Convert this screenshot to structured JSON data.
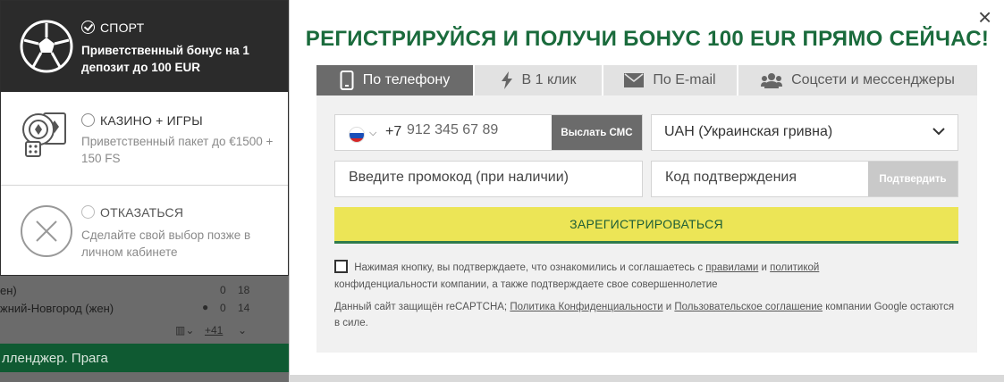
{
  "background": {
    "row1_team": "ен)",
    "row1_score1": "0",
    "row1_score2": "18",
    "row2_team": "жний-Новгород (жен)",
    "row2_score1": "0",
    "row2_score2": "14",
    "more_markets": "+41",
    "league": "лленджер. Прага"
  },
  "bonus_options": [
    {
      "title": "СПОРТ",
      "desc": "Приветственный бонус на 1 депозит до 100 EUR",
      "icon": "soccer-ball-icon",
      "selected": true
    },
    {
      "title": "КАЗИНО + ИГРЫ",
      "desc": "Приветственный пакет до €1500 + 150 FS",
      "icon": "casino-chip-cards-icon",
      "selected": false
    },
    {
      "title": "ОТКАЗАТЬСЯ",
      "desc": "Сделайте свой выбор позже в личном кабинете",
      "icon": "close-circle-icon",
      "selected": false
    }
  ],
  "modal": {
    "headline": "РЕГИСТРИРУЙСЯ И ПОЛУЧИ БОНУС 100 EUR ПРЯМО СЕЙЧАС!",
    "close": "×",
    "tabs": [
      {
        "label": "По телефону",
        "icon": "phone-icon",
        "active": true
      },
      {
        "label": "В 1 клик",
        "icon": "lightning-icon",
        "active": false
      },
      {
        "label": "По E-mail",
        "icon": "envelope-icon",
        "active": false
      },
      {
        "label": "Соцсети и мессенджеры",
        "icon": "users-icon",
        "active": false
      }
    ],
    "phone_prefix": "+7",
    "phone_placeholder": "912 345 67 89",
    "send_sms": "Выслать СМС",
    "currency": "UAH (Украинская гривна)",
    "promo_placeholder": "Введите промокод (при наличии)",
    "code_placeholder": "Код подтверждения",
    "confirm": "Подтвердить",
    "register": "ЗАРЕГИСТРИРОВАТЬСЯ",
    "agree_1": "Нажимая кнопку, вы подтверждаете, что ознакомились и соглашаетесь с",
    "agree_rules": "правилами",
    "agree_and": "и",
    "agree_policy": "политикой",
    "agree_2": "конфиденциальности компании, а также подтверждаете свое совершеннолетие",
    "captcha_1": "Данный сайт защищён reCAPTCHA;",
    "captcha_privacy": "Политика Конфиденциальности",
    "captcha_and": "и",
    "captcha_terms": "Пользовательское соглашение",
    "captcha_2": "компании Google остаются в силе."
  },
  "colors": {
    "brand_green": "#1a6b3c",
    "register_yellow": "#ece556",
    "tab_active": "#6b6b6b"
  }
}
